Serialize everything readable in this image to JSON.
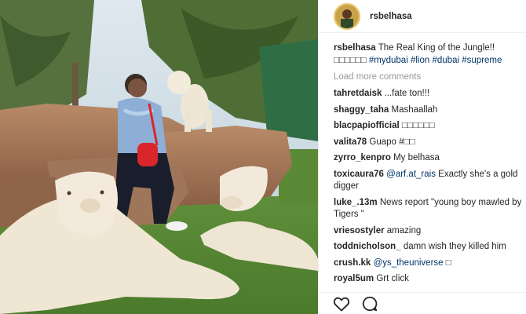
{
  "post": {
    "username": "rsbelhasa",
    "caption_user": "rsbelhasa",
    "caption_text": "The Real King of the Jungle!! ",
    "caption_emojis": "□□□□□□",
    "hashtags": [
      "#mydubai",
      "#lion",
      "#dubai",
      "#supreme"
    ]
  },
  "load_more": "Load more comments",
  "comments": [
    {
      "user": "tahretdaisk",
      "text": "...fate ton!!!"
    },
    {
      "user": "shaggy_taha",
      "text": "Mashaallah"
    },
    {
      "user": "blacpapiofficial",
      "text": "□□□□□□"
    },
    {
      "user": "valita78",
      "text": "Guapo #□□"
    },
    {
      "user": "zyrro_kenpro",
      "text": "My belhasa"
    },
    {
      "user": "toxicaura76",
      "mention": "@arf.at_rais",
      "text": " Exactly she's a gold digger"
    },
    {
      "user": "luke_.13m",
      "text": "News report \"young boy mawled by Tigers \""
    },
    {
      "user": "vriesostyler",
      "text": "amazing"
    },
    {
      "user": "toddnicholson_",
      "text": "damn wish they killed him"
    },
    {
      "user": "crush.kk",
      "mention": "@ys_theuniverse",
      "text": " □"
    },
    {
      "user": "royal5um",
      "text": "Grt click"
    }
  ],
  "icons": {
    "like": "heart-icon",
    "comment": "comment-icon"
  },
  "colors": {
    "link": "#003569",
    "muted": "#999999",
    "text": "#262626"
  }
}
